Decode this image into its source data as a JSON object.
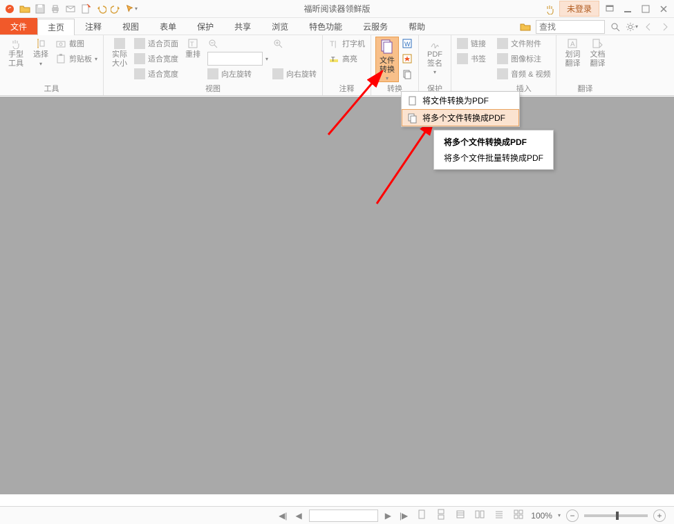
{
  "titlebar": {
    "app_title": "福昕阅读器领鲜版",
    "login_label": "未登录"
  },
  "menubar": {
    "tabs": [
      "文件",
      "主页",
      "注释",
      "视图",
      "表单",
      "保护",
      "共享",
      "浏览",
      "特色功能",
      "云服务",
      "帮助"
    ],
    "active_index": 1,
    "search_placeholder": "查找"
  },
  "ribbon": {
    "groups": {
      "tools": {
        "label": "工具",
        "hand": "手型\n工具",
        "select": "选择",
        "snapshot": "截图",
        "clipboard": "剪贴板"
      },
      "view": {
        "label": "视图",
        "actual": "实际\n大小",
        "fitpage": "适合页面",
        "fitwidth": "适合宽度",
        "fitvisible": "适合宽度",
        "reflow": "重排",
        "rotleft": "向左旋转",
        "rotright": "向右旋转"
      },
      "comment": {
        "label": "注释",
        "typewriter": "打字机",
        "highlight": "高亮"
      },
      "convert": {
        "label": "转换",
        "file_convert": "文件\n转换"
      },
      "protect": {
        "label": "保护",
        "pdf_sign": "PDF\n签名"
      },
      "links": {
        "links": "链接",
        "bookmark": "书签"
      },
      "insert": {
        "label": "插入",
        "attach": "文件附件",
        "image_annot": "图像标注",
        "av": "音频 & 视频"
      },
      "translate": {
        "label": "翻译",
        "word": "划词\n翻译",
        "doc": "文档\n翻译"
      }
    }
  },
  "convert_menu": {
    "items": [
      "将文件转换为PDF",
      "将多个文件转换成PDF"
    ],
    "selected_index": 1
  },
  "tooltip": {
    "title": "将多个文件转换成PDF",
    "body": "将多个文件批量转换成PDF"
  },
  "statusbar": {
    "zoom_text": "100%"
  }
}
